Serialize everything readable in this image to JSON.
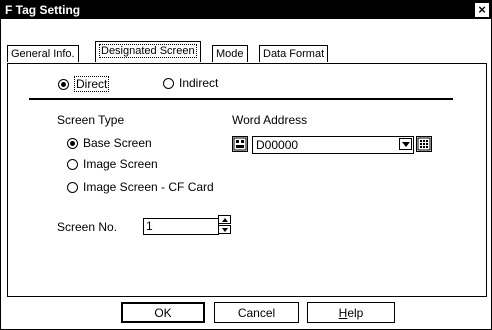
{
  "window": {
    "title": "F Tag Setting",
    "close_glyph": "×"
  },
  "tabs": [
    {
      "label": "General Info."
    },
    {
      "label": "Designated Screen",
      "active": true
    },
    {
      "label": "Mode"
    },
    {
      "label": "Data Format"
    }
  ],
  "addressing": {
    "direct_label": "Direct",
    "indirect_label": "Indirect",
    "selected": "Direct"
  },
  "screen_type": {
    "heading": "Screen Type",
    "options": [
      "Base Screen",
      "Image Screen",
      "Image Screen - CF Card"
    ],
    "selected": "Base Screen"
  },
  "word_address": {
    "heading": "Word Address",
    "value": "D00000"
  },
  "screen_no": {
    "label": "Screen No.",
    "value": "1"
  },
  "buttons": {
    "ok": "OK",
    "cancel": "Cancel",
    "help_prefix": "H",
    "help_rest": "elp"
  }
}
